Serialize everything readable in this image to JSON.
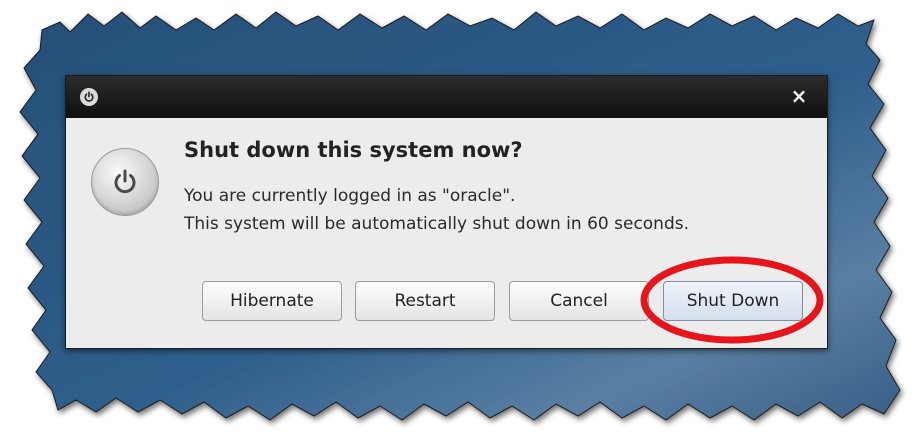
{
  "dialog": {
    "heading": "Shut down this system now?",
    "message_line1": "You are currently logged in as \"oracle\".",
    "message_line2": "This system will be automatically shut down in 60 seconds.",
    "close_glyph": "×",
    "window_icon": "power-icon",
    "main_icon": "power-icon",
    "buttons": {
      "hibernate": "Hibernate",
      "restart": "Restart",
      "cancel": "Cancel",
      "shutdown": "Shut Down"
    }
  },
  "colors": {
    "background_blue": "#2e5a85",
    "highlight_ellipse": "#e8141b"
  }
}
